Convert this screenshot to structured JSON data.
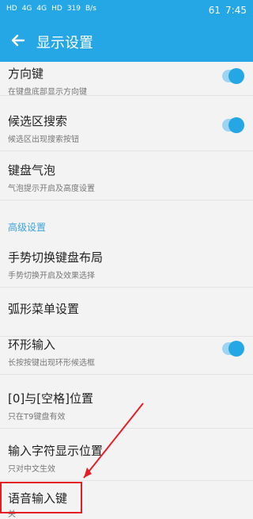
{
  "status_bar": {
    "signals": [
      "HD",
      "4G",
      "4G",
      "HD"
    ],
    "speed": "319",
    "speed_unit": "B/s",
    "battery": "61",
    "time": "7:45"
  },
  "header": {
    "title": "显示设置"
  },
  "settings": [
    {
      "title": "方向键",
      "subtitle": "在键盘底部显示方向键",
      "toggle": true
    },
    {
      "title": "候选区搜索",
      "subtitle": "候选区出现搜索按钮",
      "toggle": true
    },
    {
      "title": "键盘气泡",
      "subtitle": "气泡提示开启及高度设置",
      "toggle": false
    },
    {
      "title": "手势切换键盘布局",
      "subtitle": "手势切换开启及效果选择",
      "toggle": false
    },
    {
      "title": "弧形菜单设置",
      "subtitle": "",
      "toggle": false
    },
    {
      "title": "环形输入",
      "subtitle": "长按按键出现环形候选框",
      "toggle": true
    },
    {
      "title": "[0]与[空格]位置",
      "subtitle": "只在T9键盘有效",
      "toggle": false
    },
    {
      "title": "输入字符显示位置",
      "subtitle": "只对中文生效",
      "toggle": false
    },
    {
      "title": "语音输入键",
      "subtitle": "关",
      "toggle": false
    }
  ],
  "section": {
    "title": "高级设置"
  },
  "colors": {
    "primary": "#25a7e6",
    "accent_red": "#e31e24"
  }
}
